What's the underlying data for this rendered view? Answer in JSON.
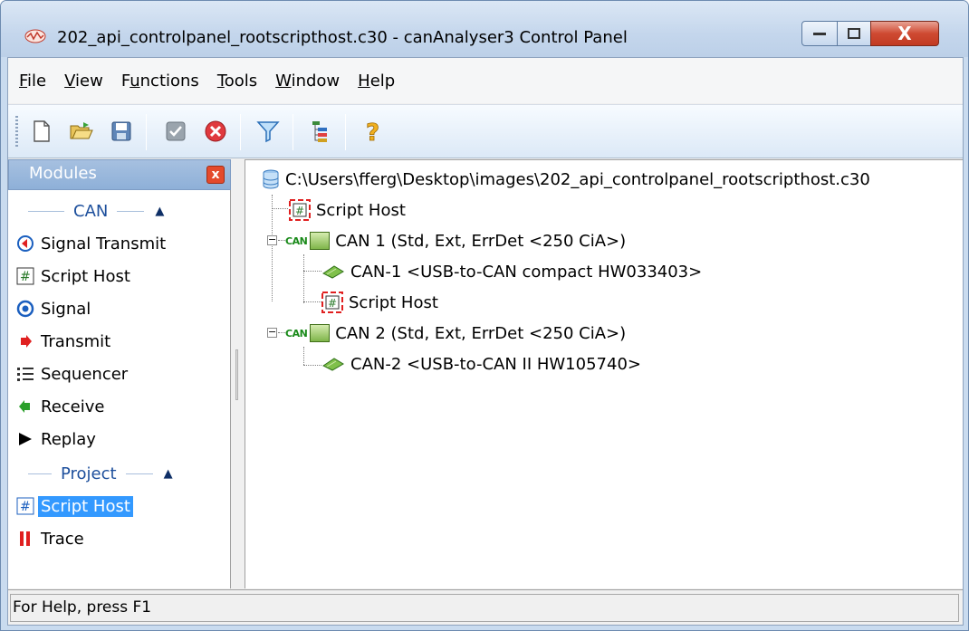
{
  "window": {
    "title": "202_api_controlpanel_rootscripthost.c30 - canAnalyser3 Control Panel",
    "close_glyph": "X"
  },
  "menu": {
    "items": [
      {
        "label": "File",
        "accel": "F",
        "rest": "ile"
      },
      {
        "label": "View",
        "accel": "V",
        "rest": "iew"
      },
      {
        "label": "Functions",
        "pre": "F",
        "accel": "u",
        "rest": "nctions"
      },
      {
        "label": "Tools",
        "accel": "T",
        "rest": "ools"
      },
      {
        "label": "Window",
        "accel": "W",
        "rest": "indow"
      },
      {
        "label": "Help",
        "accel": "H",
        "rest": "elp"
      }
    ]
  },
  "toolbar": {
    "icons": [
      "new-file-icon",
      "open-folder-icon",
      "save-icon",
      "check-icon",
      "stop-icon",
      "filter-icon",
      "tree-icon",
      "help-icon"
    ]
  },
  "modules": {
    "header": "Modules",
    "close": "x",
    "groups": [
      {
        "title": "CAN",
        "items": [
          {
            "label": "Signal Transmit",
            "icon": "signal-transmit-icon"
          },
          {
            "label": "Script Host",
            "icon": "script-host-icon"
          },
          {
            "label": "Signal",
            "icon": "signal-icon"
          },
          {
            "label": "Transmit",
            "icon": "transmit-icon"
          },
          {
            "label": "Sequencer",
            "icon": "sequencer-icon"
          },
          {
            "label": "Receive",
            "icon": "receive-icon"
          },
          {
            "label": "Replay",
            "icon": "replay-icon"
          }
        ]
      },
      {
        "title": "Project",
        "items": [
          {
            "label": "Script Host",
            "icon": "script-host-icon",
            "selected": true
          },
          {
            "label": "Trace",
            "icon": "trace-icon"
          }
        ]
      }
    ]
  },
  "tree": {
    "root": "C:\\Users\\fferg\\Desktop\\images\\202_api_controlpanel_rootscripthost.c30",
    "nodes": [
      {
        "label": "Script Host"
      },
      {
        "label": "CAN 1  (Std, Ext, ErrDet <250 CiA>)",
        "logo": "CAN"
      },
      {
        "label": "CAN-1  <USB-to-CAN compact HW033403>"
      },
      {
        "label": "Script Host"
      },
      {
        "label": "CAN 2  (Std, Ext, ErrDet <250 CiA>)",
        "logo": "CAN"
      },
      {
        "label": "CAN-2  <USB-to-CAN II HW105740>"
      }
    ]
  },
  "status": {
    "text": "For Help, press F1"
  },
  "colors": {
    "selection": "#3399ff",
    "module_header": "#8eb0d8",
    "group_title": "#1d4f9c"
  }
}
